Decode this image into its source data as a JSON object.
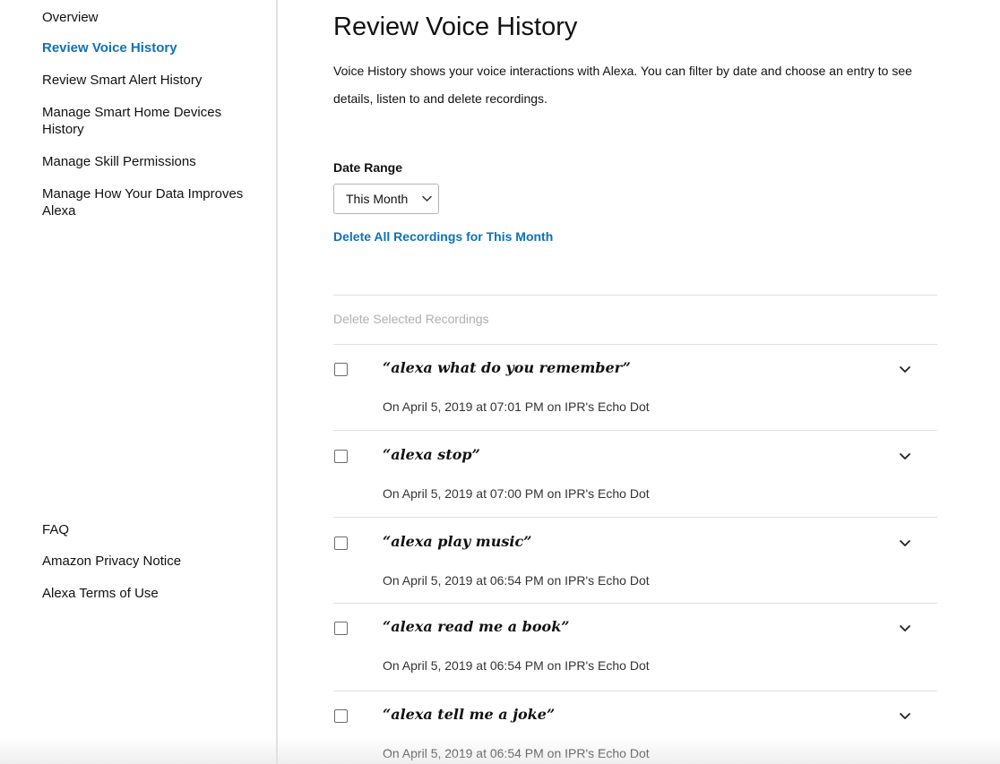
{
  "sidebar": {
    "items": [
      {
        "label": "Overview"
      },
      {
        "label": "Review Voice History"
      },
      {
        "label": "Review Smart Alert History"
      },
      {
        "label": "Manage Smart Home Devices History"
      },
      {
        "label": "Manage Skill Permissions"
      },
      {
        "label": "Manage How Your Data Improves Alexa"
      }
    ],
    "active_item": "Review Voice History",
    "footer_items": [
      {
        "label": "FAQ"
      },
      {
        "label": "Amazon Privacy Notice"
      },
      {
        "label": "Alexa Terms of Use"
      }
    ]
  },
  "main": {
    "title": "Review Voice History",
    "intro": "Voice History shows your voice interactions with Alexa. You can filter by date and choose an entry to see details, listen to and delete recordings.",
    "date_range_label": "Date Range",
    "date_range_value": "This Month",
    "delete_all_label": "Delete All Recordings for This Month",
    "delete_selected_label": "Delete Selected Recordings",
    "recordings": [
      {
        "utterance": "“alexa what do you remember”",
        "meta": "On April 5, 2019 at 07:01 PM on IPR's Echo Dot"
      },
      {
        "utterance": "“alexa stop”",
        "meta": "On April 5, 2019 at 07:00 PM on IPR's Echo Dot"
      },
      {
        "utterance": "“alexa play music”",
        "meta": "On April 5, 2019 at 06:54 PM on IPR's Echo Dot"
      },
      {
        "utterance": "“alexa read me a book”",
        "meta": "On April 5, 2019 at 06:54 PM on IPR's Echo Dot"
      },
      {
        "utterance": "“alexa tell me a joke”",
        "meta": "On April 5, 2019 at 06:54 PM on IPR's Echo Dot"
      }
    ]
  },
  "colors": {
    "link_blue": "#0e72b8",
    "text": "#111111",
    "muted": "#b0b0b0",
    "divider": "#e0e0e0"
  },
  "icons": {
    "dropdown": "chevron-down-icon",
    "expand": "chevron-down-icon",
    "checkbox": "checkbox-icon"
  }
}
